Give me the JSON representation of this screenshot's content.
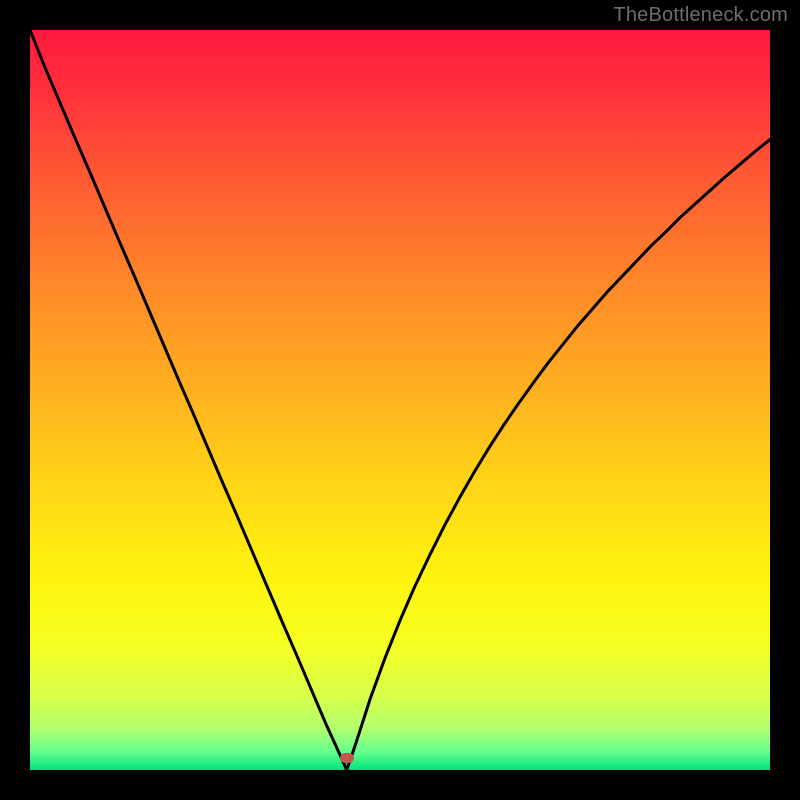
{
  "watermark": "TheBottleneck.com",
  "gradient": {
    "stops": [
      {
        "offset": 0.0,
        "color": "#ff1a3e"
      },
      {
        "offset": 0.08,
        "color": "#ff2f3c"
      },
      {
        "offset": 0.2,
        "color": "#ff5a33"
      },
      {
        "offset": 0.35,
        "color": "#ff8a29"
      },
      {
        "offset": 0.5,
        "color": "#ffb41f"
      },
      {
        "offset": 0.62,
        "color": "#ffd716"
      },
      {
        "offset": 0.74,
        "color": "#fff30e"
      },
      {
        "offset": 0.83,
        "color": "#f6ff22"
      },
      {
        "offset": 0.9,
        "color": "#d8ff4a"
      },
      {
        "offset": 0.945,
        "color": "#b0ff6e"
      },
      {
        "offset": 0.975,
        "color": "#66ff8e"
      },
      {
        "offset": 1.0,
        "color": "#00e57a"
      }
    ]
  },
  "marker": {
    "x_frac": 0.428,
    "y_frac": 0.984,
    "color": "#c0584e"
  },
  "curve": {
    "stroke": "#000000",
    "stroke_width": 3
  },
  "chart_data": {
    "type": "line",
    "title": "",
    "xlabel": "",
    "ylabel": "",
    "xlim": [
      0,
      100
    ],
    "ylim": [
      0,
      100
    ],
    "grid": false,
    "legend": false,
    "series": [
      {
        "name": "bottleneck-curve",
        "x": [
          0,
          2,
          4,
          6,
          8,
          10,
          12,
          14,
          16,
          18,
          20,
          22,
          24,
          26,
          28,
          30,
          32,
          34,
          36,
          38,
          40,
          41,
          42,
          42.8,
          44,
          46,
          48,
          50,
          52,
          54,
          56,
          58,
          60,
          62,
          64,
          66,
          68,
          70,
          72,
          74,
          76,
          78,
          80,
          82,
          84,
          86,
          88,
          90,
          92,
          94,
          96,
          98,
          100
        ],
        "y": [
          100,
          95,
          90.3,
          85.6,
          81,
          76.3,
          71.6,
          67,
          62.3,
          57.6,
          52.9,
          48.3,
          43.6,
          38.9,
          34.3,
          29.6,
          24.9,
          20.2,
          15.6,
          10.9,
          6.2,
          4,
          1.8,
          0,
          3.5,
          9.7,
          15.2,
          20.2,
          24.8,
          29,
          33,
          36.7,
          40.2,
          43.5,
          46.6,
          49.5,
          52.3,
          55,
          57.5,
          60,
          62.3,
          64.6,
          66.7,
          68.8,
          70.9,
          72.8,
          74.8,
          76.6,
          78.4,
          80.2,
          81.9,
          83.6,
          85.2
        ]
      }
    ],
    "annotations": [
      {
        "type": "marker",
        "x": 42.8,
        "y": 1.6,
        "label": "optimal-point"
      }
    ]
  }
}
